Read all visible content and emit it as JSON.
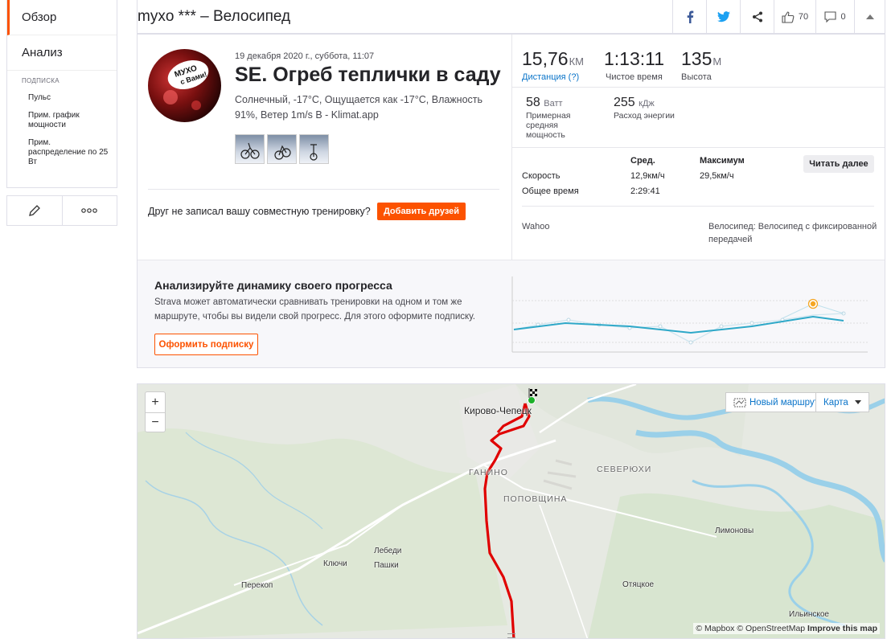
{
  "sidebar": {
    "tabs": [
      {
        "label": "Обзор",
        "active": true
      },
      {
        "label": "Анализ",
        "active": false
      }
    ],
    "subscription_header": "ПОДПИСКА",
    "sub_items": [
      "Пульс",
      "Прим. график мощности",
      "Прим. распределение по 25 Вт"
    ]
  },
  "header": {
    "athlete": "myxo ***",
    "separator": " – ",
    "activity_type": "Велосипед",
    "kudos_count": "70",
    "comments_count": "0"
  },
  "activity": {
    "avatar_text": "МУХО с Вами!",
    "date": "19 декабря 2020 г., суббота, 11:07",
    "title": "SE. Огреб теплички в саду",
    "weather": "Солнечный, -17°C, Ощущается как -17°C, Влажность 91%, Ветер 1m/s В - Klimat.app",
    "friend_text": "Друг не записал вашу совместную тренировку?",
    "add_friends": "Добавить друзей"
  },
  "stats": {
    "distance": {
      "value": "15,76",
      "unit": "км",
      "label": "Дистанция (?)"
    },
    "moving_time": {
      "value": "1:13:11",
      "label": "Чистое время"
    },
    "elevation": {
      "value": "135",
      "unit": "м",
      "label": "Высота"
    },
    "power": {
      "value": "58",
      "unit": "Ватт",
      "label": "Примерная средняя мощность"
    },
    "energy": {
      "value": "255",
      "unit": "кДж",
      "label": "Расход энергии"
    },
    "table": {
      "col_avg": "Сред.",
      "col_max": "Максимум",
      "rows": [
        {
          "label": "Скорость",
          "avg": "12,9км/ч",
          "max": "29,5км/ч"
        },
        {
          "label": "Общее время",
          "avg": "2:29:41",
          "max": ""
        }
      ]
    },
    "read_more": "Читать далее",
    "device": "Wahoo",
    "bike": "Велосипед: Велосипед с фиксированной передачей"
  },
  "promo": {
    "title": "Анализируйте динамику своего прогресса",
    "text": "Strava может автоматически сравнивать тренировки на одном и том же маршруте, чтобы вы видели свой прогресс. Для этого оформите подписку.",
    "button": "Оформить подписку"
  },
  "map": {
    "zoom_in": "+",
    "zoom_out": "−",
    "new_route": "Новый маршрут",
    "map_type": "Карта",
    "labels": {
      "kirovo": "Кирово-Чепецк",
      "ganino": "ГАНИНО",
      "severyukhi": "СЕВЕРЮХИ",
      "povoshchina": "ПОПОВЩИНА",
      "limonovy": "Лимоновы",
      "lebedi": "Лебеди",
      "pashki": "Пашки",
      "klyuchi": "Ключи",
      "perekop": "Перекоп",
      "otyatskoe": "Отяцкое",
      "ilinskoe": "Ильинское"
    },
    "attribution_1": "© Mapbox",
    "attribution_2": "© OpenStreetMap",
    "attribution_3": "Improve this map"
  },
  "colors": {
    "accent": "#fc5200",
    "link": "#0a74c9",
    "route": "#e00000",
    "trend": "#2ea8c8"
  }
}
